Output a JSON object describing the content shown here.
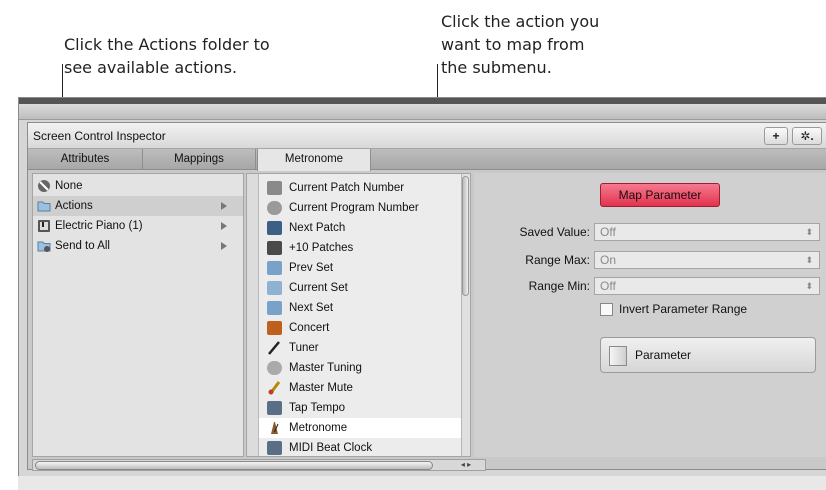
{
  "callouts": {
    "left_line1": "Click the Actions folder to",
    "left_line2": "see available actions.",
    "right_line1": "Click the action you",
    "right_line2": "want to map from",
    "right_line3": "the submenu."
  },
  "inspector": {
    "title": "Screen Control Inspector",
    "add_button": "+",
    "gear_button": "✲.",
    "tabs": [
      "Attributes",
      "Mappings",
      "Metronome"
    ]
  },
  "folders": [
    {
      "label": "None",
      "icon": "none-icon"
    },
    {
      "label": "Actions",
      "icon": "folder-icon"
    },
    {
      "label": "Electric Piano (1)",
      "icon": "instrument-icon"
    },
    {
      "label": "Send to All",
      "icon": "send-icon"
    }
  ],
  "actions": [
    {
      "label": "Current Patch Number",
      "icon": "patch-number-icon"
    },
    {
      "label": "Current Program Number",
      "icon": "program-number-icon"
    },
    {
      "label": "Next Patch",
      "icon": "next-patch-icon"
    },
    {
      "label": "+10 Patches",
      "icon": "plus-ten-icon"
    },
    {
      "label": "Prev Set",
      "icon": "prev-set-icon"
    },
    {
      "label": "Current Set",
      "icon": "current-set-icon"
    },
    {
      "label": "Next Set",
      "icon": "next-set-icon"
    },
    {
      "label": "Concert",
      "icon": "concert-icon"
    },
    {
      "label": "Tuner",
      "icon": "tuner-icon"
    },
    {
      "label": "Master Tuning",
      "icon": "master-tuning-icon"
    },
    {
      "label": "Master Mute",
      "icon": "master-mute-icon"
    },
    {
      "label": "Tap Tempo",
      "icon": "tap-tempo-icon"
    },
    {
      "label": "Metronome",
      "icon": "metronome-icon"
    },
    {
      "label": "MIDI Beat Clock",
      "icon": "midi-clock-icon"
    }
  ],
  "right": {
    "map_button": "Map Parameter",
    "saved_value_label": "Saved Value:",
    "saved_value": "Off",
    "range_max_label": "Range Max:",
    "range_max": "On",
    "range_min_label": "Range Min:",
    "range_min": "Off",
    "invert_label": "Invert Parameter Range",
    "parameter_label": "Parameter"
  },
  "colors": {
    "map_button": "#e84a63"
  }
}
